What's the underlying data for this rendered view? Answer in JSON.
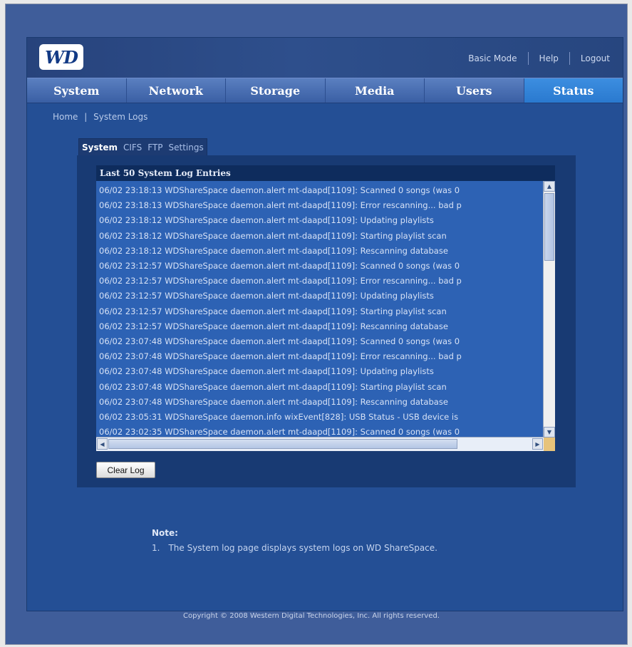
{
  "header": {
    "logo_text": "WD",
    "links": [
      "Basic Mode",
      "Help",
      "Logout"
    ]
  },
  "nav": {
    "items": [
      "System",
      "Network",
      "Storage",
      "Media",
      "Users",
      "Status"
    ],
    "active": "Status"
  },
  "breadcrumb": {
    "home": "Home",
    "separator": "|",
    "current": "System Logs"
  },
  "subtabs": {
    "items": [
      "System",
      "CIFS",
      "FTP",
      "Settings"
    ],
    "active": "System"
  },
  "log": {
    "title": "Last 50 System Log Entries",
    "lines": [
      "06/02 23:18:13  WDShareSpace daemon.alert mt-daapd[1109]: Scanned 0 songs (was 0",
      "06/02 23:18:13  WDShareSpace daemon.alert mt-daapd[1109]: Error rescanning... bad p",
      "06/02 23:18:12  WDShareSpace daemon.alert mt-daapd[1109]: Updating playlists",
      "06/02 23:18:12  WDShareSpace daemon.alert mt-daapd[1109]: Starting playlist scan",
      "06/02 23:18:12  WDShareSpace daemon.alert mt-daapd[1109]: Rescanning database",
      "06/02 23:12:57  WDShareSpace daemon.alert mt-daapd[1109]: Scanned 0 songs (was 0",
      "06/02 23:12:57  WDShareSpace daemon.alert mt-daapd[1109]: Error rescanning... bad p",
      "06/02 23:12:57  WDShareSpace daemon.alert mt-daapd[1109]: Updating playlists",
      "06/02 23:12:57  WDShareSpace daemon.alert mt-daapd[1109]: Starting playlist scan",
      "06/02 23:12:57  WDShareSpace daemon.alert mt-daapd[1109]: Rescanning database",
      "06/02 23:07:48  WDShareSpace daemon.alert mt-daapd[1109]: Scanned 0 songs (was 0",
      "06/02 23:07:48  WDShareSpace daemon.alert mt-daapd[1109]: Error rescanning... bad p",
      "06/02 23:07:48  WDShareSpace daemon.alert mt-daapd[1109]: Updating playlists",
      "06/02 23:07:48  WDShareSpace daemon.alert mt-daapd[1109]: Starting playlist scan",
      "06/02 23:07:48  WDShareSpace daemon.alert mt-daapd[1109]: Rescanning database",
      "06/02 23:05:31  WDShareSpace daemon.info wixEvent[828]: USB Status - USB device is",
      "06/02 23:02:35  WDShareSpace daemon.alert mt-daapd[1109]: Scanned 0 songs (was 0"
    ],
    "clear_button": "Clear Log"
  },
  "note": {
    "label": "Note:",
    "items": [
      {
        "num": "1.",
        "text": "The System log page displays system logs on WD ShareSpace."
      }
    ]
  },
  "footer": {
    "copyright": "Copyright © 2008 Western Digital Technologies, Inc. All rights reserved."
  },
  "colors": {
    "active_tab": "#2f83d8",
    "background": "#244f95",
    "log_area": "#2d62b4",
    "scroll_corner": "#e7c37a"
  }
}
